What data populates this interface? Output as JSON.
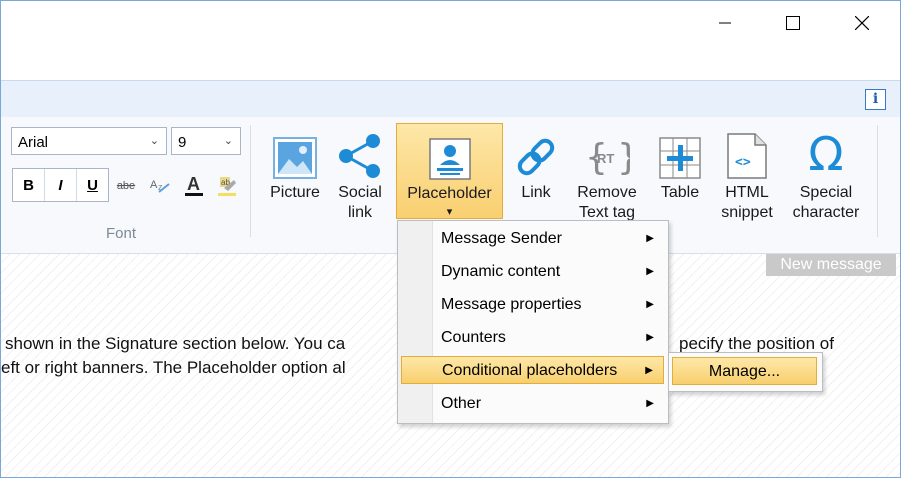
{
  "window": {
    "controls": {
      "minimize": "minimize-icon",
      "maximize": "maximize-icon",
      "close": "close-icon"
    },
    "info_icon": "i"
  },
  "ribbon": {
    "font_name": "Arial",
    "font_size": "9",
    "format": {
      "bold": "B",
      "italic": "I",
      "underline": "U",
      "strikethrough": "abe"
    },
    "font_group_label": "Font",
    "buttons": [
      {
        "label1": "Picture",
        "label2": "",
        "icon": "picture-icon"
      },
      {
        "label1": "Social",
        "label2": "link",
        "icon": "share-icon"
      },
      {
        "label1": "Placeholder",
        "label2": "▾",
        "icon": "placeholder-icon"
      },
      {
        "label1": "Link",
        "label2": "",
        "icon": "link-icon"
      },
      {
        "label1": "Remove",
        "label2": "Text tag",
        "icon": "rt-icon"
      },
      {
        "label1": "Table",
        "label2": "",
        "icon": "table-icon"
      },
      {
        "label1": "HTML",
        "label2": "snippet",
        "icon": "html-icon"
      },
      {
        "label1": "Special",
        "label2": "character",
        "icon": "omega-icon"
      }
    ]
  },
  "content": {
    "badge": "New message",
    "line1a": "shown in the Signature section below. You ca",
    "line1b": "pecify the position of",
    "line2": "eft or right banners. The Placeholder option al"
  },
  "menu": {
    "items": [
      {
        "label": "Message Sender"
      },
      {
        "label": "Dynamic content"
      },
      {
        "label": "Message properties"
      },
      {
        "label": "Counters"
      },
      {
        "label": "Conditional placeholders"
      },
      {
        "label": "Other"
      }
    ],
    "submenu_item": "Manage..."
  },
  "colors": {
    "accent": "#f9cf70",
    "icon_blue": "#1e8bd6",
    "border": "#7aa7d8"
  }
}
